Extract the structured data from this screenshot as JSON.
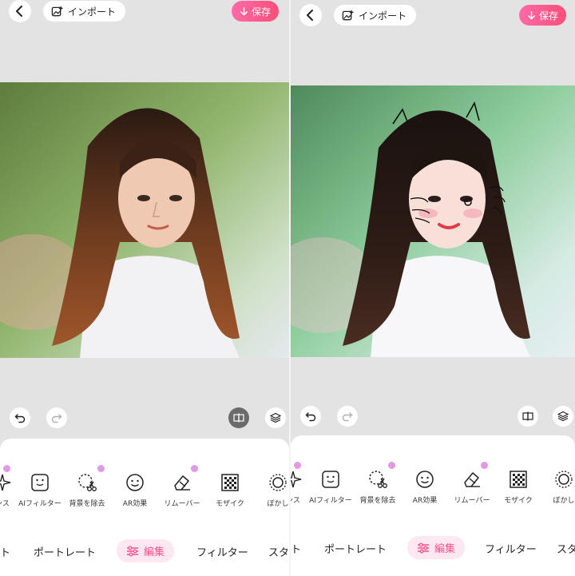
{
  "header": {
    "import_label": "インポート",
    "save_label": "保存"
  },
  "tools": [
    {
      "name": "balance",
      "label": "ンス",
      "icon": "sparkle-icon",
      "premium": true
    },
    {
      "name": "ai-filter",
      "label": "AIフィルター",
      "icon": "ai-face-icon",
      "premium": false
    },
    {
      "name": "remove-bg",
      "label": "背景を除去",
      "icon": "scissors-icon",
      "premium": true
    },
    {
      "name": "ar-effect",
      "label": "AR効果",
      "icon": "smiley-icon",
      "premium": false
    },
    {
      "name": "remover",
      "label": "リムーバー",
      "icon": "eraser-icon",
      "premium": true
    },
    {
      "name": "mosaic",
      "label": "モザイク",
      "icon": "mosaic-icon",
      "premium": false
    },
    {
      "name": "blur",
      "label": "ぼかし",
      "icon": "blur-icon",
      "premium": false
    }
  ],
  "bottom_nav": [
    {
      "name": "start",
      "label": "ト"
    },
    {
      "name": "portrait",
      "label": "ポートレート"
    },
    {
      "name": "edit",
      "label": "編集",
      "active": true
    },
    {
      "name": "filter",
      "label": "フィルター"
    },
    {
      "name": "sticker",
      "label": "スタ"
    }
  ],
  "colors": {
    "accent": "#ff4f8f",
    "save_gradient_start": "#ff6aa6",
    "save_gradient_end": "#ff4f79",
    "background": "#e3e3e3"
  }
}
